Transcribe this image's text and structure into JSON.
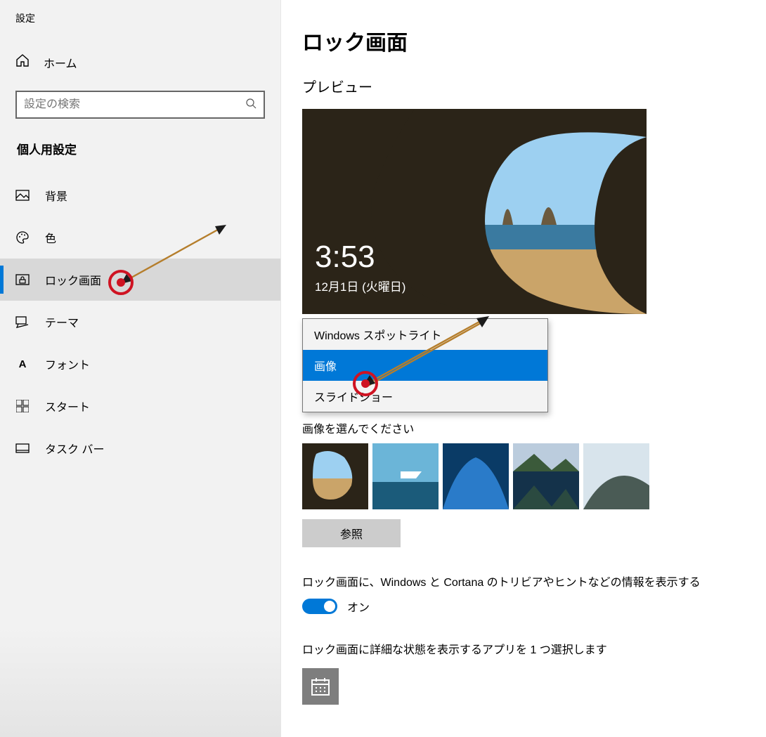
{
  "window_title": "設定",
  "home_label": "ホーム",
  "search_placeholder": "設定の検索",
  "section": "個人用設定",
  "nav": [
    {
      "label": "背景"
    },
    {
      "label": "色"
    },
    {
      "label": "ロック画面"
    },
    {
      "label": "テーマ"
    },
    {
      "label": "フォント"
    },
    {
      "label": "スタート"
    },
    {
      "label": "タスク バー"
    }
  ],
  "page": {
    "title": "ロック画面",
    "preview_label": "プレビュー",
    "clock": "3:53",
    "date": "12月1日 (火曜日)",
    "dropdown": {
      "options": [
        "Windows スポットライト",
        "画像",
        "スライドショー"
      ],
      "selected": "画像"
    },
    "pick_label": "画像を選んでください",
    "browse": "参照",
    "tip_label": "ロック画面に、Windows と Cortana のトリビアやヒントなどの情報を表示する",
    "toggle_state": "オン",
    "detail_label": "ロック画面に詳細な状態を表示するアプリを 1 つ選択します"
  }
}
